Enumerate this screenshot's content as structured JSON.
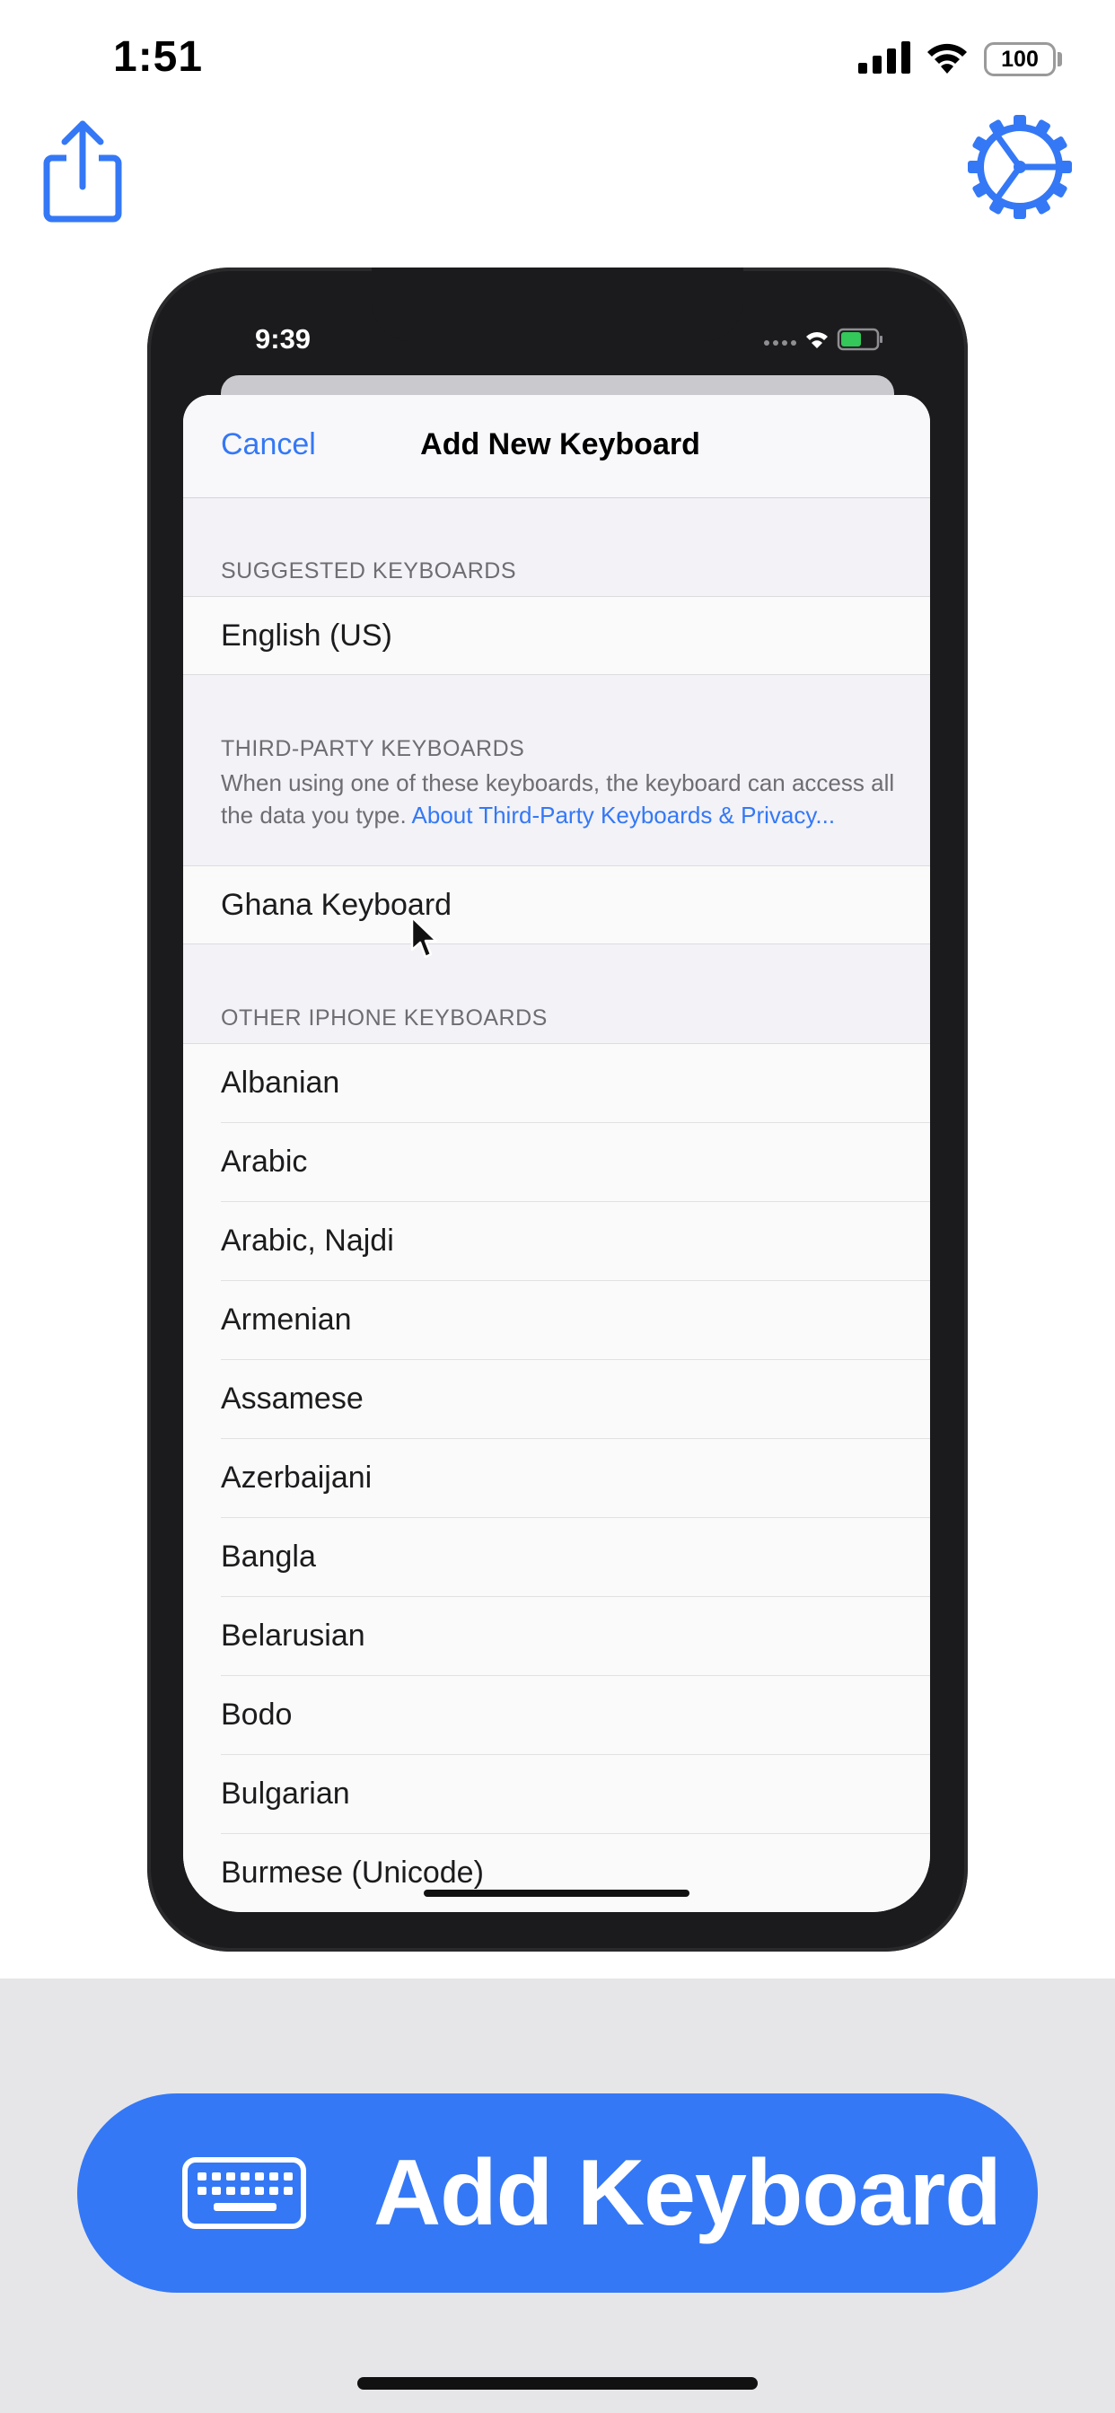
{
  "status_bar": {
    "time": "1:51",
    "battery": "100",
    "icons": [
      "cellular-signal-icon",
      "wifi-icon",
      "battery-icon"
    ]
  },
  "toolbar": {
    "share_icon": "share-icon",
    "settings_icon": "gear-icon"
  },
  "colors": {
    "accent": "#3478f6",
    "background": "#ffffff",
    "bottom_band": "#e6e6e8",
    "phone_frame": "#1b1b1d",
    "sheet_background": "#f2f2f7",
    "secondary_text": "#6d6d72"
  },
  "preview": {
    "status_time": "9:39",
    "nav": {
      "cancel": "Cancel",
      "title": "Add New Keyboard"
    },
    "suggested": {
      "header": "SUGGESTED KEYBOARDS",
      "items": [
        "English (US)"
      ]
    },
    "third_party": {
      "header": "THIRD-PARTY KEYBOARDS",
      "description": "When using one of these keyboards, the keyboard can access all the data you type.",
      "link": "About Third-Party Keyboards & Privacy...",
      "items": [
        "Ghana Keyboard"
      ]
    },
    "other": {
      "header": "OTHER IPHONE KEYBOARDS",
      "items": [
        "Albanian",
        "Arabic",
        "Arabic, Najdi",
        "Armenian",
        "Assamese",
        "Azerbaijani",
        "Bangla",
        "Belarusian",
        "Bodo",
        "Bulgarian",
        "Burmese (Unicode)"
      ]
    }
  },
  "cta": {
    "label": "Add Keyboard",
    "icon": "keyboard-icon"
  }
}
